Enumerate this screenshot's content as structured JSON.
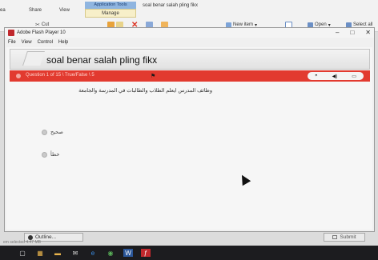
{
  "ribbon": {
    "tab_share": "Share",
    "tab_view": "View",
    "context_header": "Application Tools",
    "tab_manage": "Manage",
    "window_title": "soal benar salah pling fikx",
    "cut_label": "Cut",
    "new_item_label": "New item",
    "open_label": "Open",
    "select_all_label": "Select all",
    "left_fragment": "ea"
  },
  "flash_window": {
    "title": "Adobe Flash Player 10",
    "menu": [
      "File",
      "View",
      "Control",
      "Help"
    ],
    "controls": {
      "minimize": "–",
      "maximize": "□",
      "close": "✕"
    }
  },
  "quiz": {
    "title": "soal benar salah pling fikx",
    "question_label": "Question 1 of 15 \\ True/False \\ 5",
    "question_text": "وظائف المدرس ايعلم الطلاب والطالبات في المدرسة والجامعة",
    "options": [
      "صحيح",
      "خطأ"
    ],
    "outline_label": "Outline...",
    "submit_label": "Submit",
    "accent_color": "#e23a2f"
  },
  "status_bar": {
    "text": "em selected 4.47 MB"
  },
  "taskbar": {
    "icons": [
      "start-icon",
      "file-explorer-icon",
      "folder-icon",
      "mail-icon",
      "edge-icon",
      "chrome-icon",
      "word-icon",
      "flash-icon"
    ]
  }
}
